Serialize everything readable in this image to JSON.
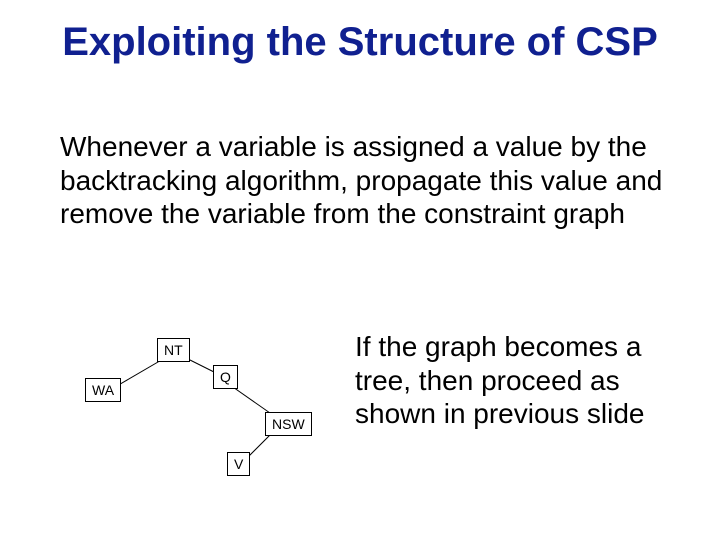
{
  "title": "Exploiting the Structure of CSP",
  "body": "Whenever a variable is assigned a value by the backtracking algorithm, propagate this value and remove the variable from the constraint graph",
  "sideText": "If the graph becomes a tree, then proceed as shown in previous slide",
  "nodes": {
    "nt": "NT",
    "wa": "WA",
    "q": "Q",
    "nsw": "NSW",
    "v": "V"
  }
}
